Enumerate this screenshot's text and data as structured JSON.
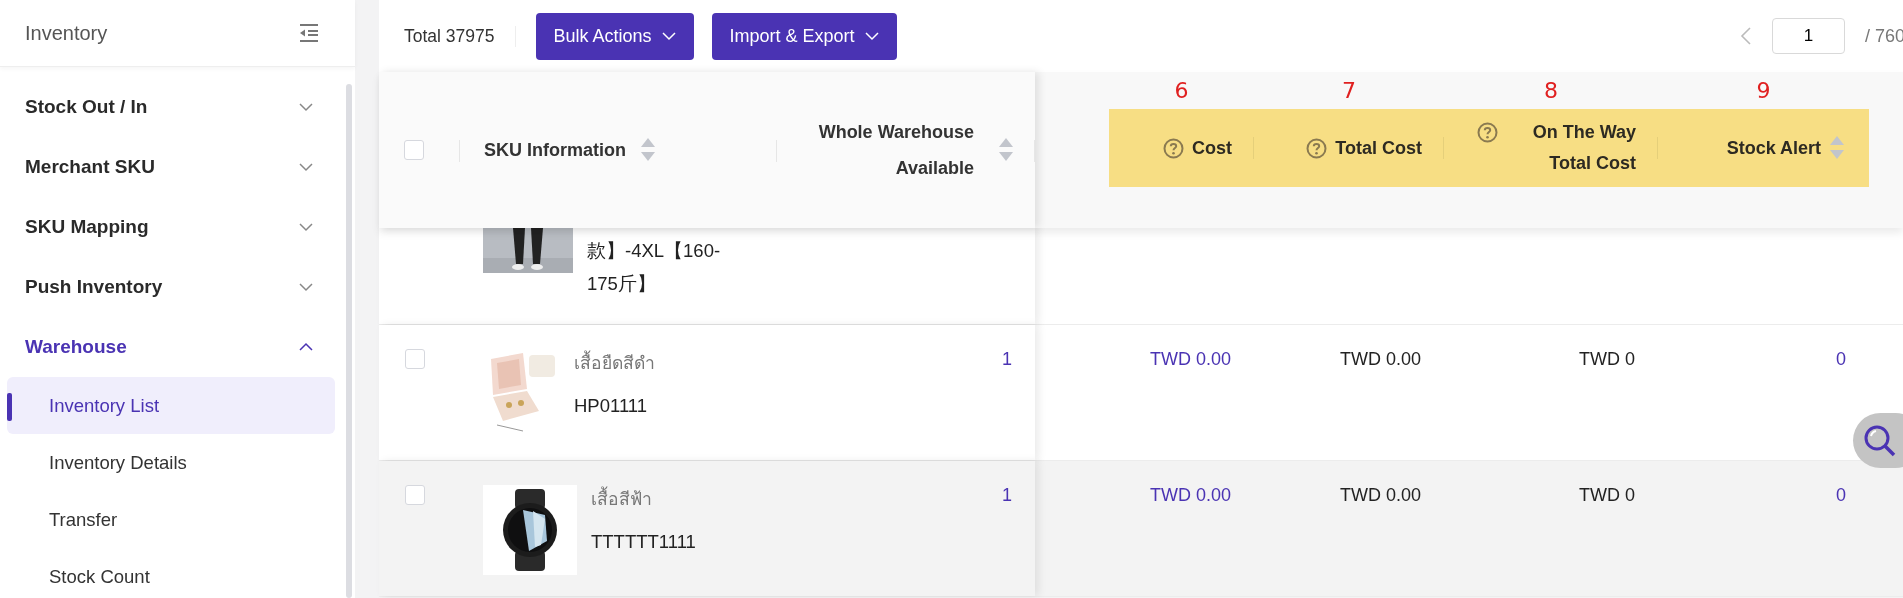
{
  "sidebar": {
    "title": "Inventory",
    "items": [
      {
        "label": "Stock Out / In",
        "expanded": false
      },
      {
        "label": "Merchant SKU",
        "expanded": false
      },
      {
        "label": "SKU Mapping",
        "expanded": false
      },
      {
        "label": "Push Inventory",
        "expanded": false
      },
      {
        "label": "Warehouse",
        "expanded": true,
        "children": [
          {
            "label": "Inventory List",
            "selected": true
          },
          {
            "label": "Inventory Details",
            "selected": false
          },
          {
            "label": "Transfer",
            "selected": false
          },
          {
            "label": "Stock Count",
            "selected": false
          }
        ]
      }
    ]
  },
  "toolbar": {
    "total": "Total 37975",
    "buttons": [
      "Bulk Actions",
      "Import & Export"
    ]
  },
  "pagination": {
    "prev_disabled": true,
    "page": "1",
    "of": "/ 760"
  },
  "table": {
    "select_all": {
      "checked": false
    },
    "columns": [
      {
        "label": "SKU Information",
        "sortable": true,
        "help": false
      },
      {
        "label": "Whole Warehouse Available",
        "sortable": true,
        "help": false
      },
      {
        "label": "Cost",
        "sortable": false,
        "help": true,
        "marker": "6"
      },
      {
        "label": "Total Cost",
        "sortable": false,
        "help": true,
        "marker": "7"
      },
      {
        "label": "On The Way Total Cost",
        "sortable": false,
        "help": true,
        "marker": "8"
      },
      {
        "label": "Stock Alert",
        "sortable": true,
        "help": false,
        "marker": "9"
      }
    ],
    "rows": [
      {
        "partial": true,
        "hovered": false,
        "sku": "款】-4XL【160-175斤】"
      },
      {
        "partial": false,
        "hovered": false,
        "checked": false,
        "name": "เสื้อยืดสีดำ",
        "sku": "HP01111",
        "available": "1",
        "cost": "TWD 0.00",
        "total_cost": "TWD 0.00",
        "on_the_way_total_cost": "TWD 0",
        "stock_alert": "0"
      },
      {
        "partial": false,
        "hovered": true,
        "checked": false,
        "name": "เสื้อสีฟ้า",
        "sku": "TTTTTT1111",
        "available": "1",
        "cost": "TWD 0.00",
        "total_cost": "TWD 0.00",
        "on_the_way_total_cost": "TWD 0",
        "stock_alert": "0"
      }
    ]
  }
}
